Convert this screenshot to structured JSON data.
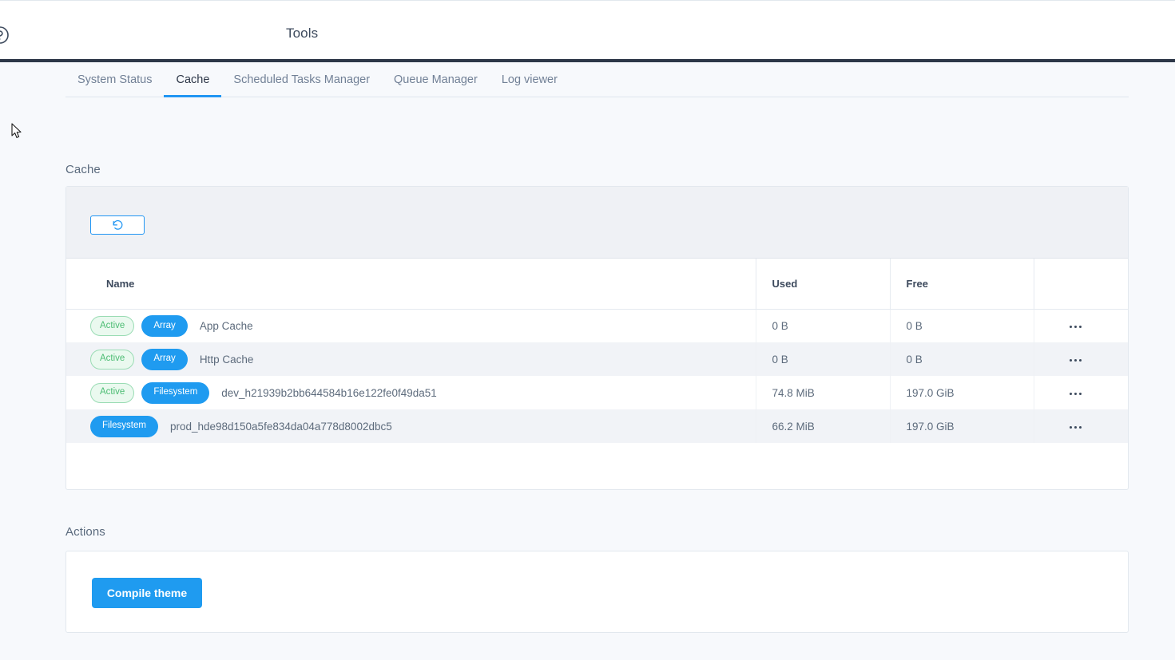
{
  "header": {
    "title": "Tools",
    "help_icon": "help-circle-icon"
  },
  "tabs": [
    {
      "label": "System Status",
      "active": false
    },
    {
      "label": "Cache",
      "active": true
    },
    {
      "label": "Scheduled Tasks Manager",
      "active": false
    },
    {
      "label": "Queue Manager",
      "active": false
    },
    {
      "label": "Log viewer",
      "active": false
    }
  ],
  "cache": {
    "section_label": "Cache",
    "toolbar": {
      "refresh_icon": "refresh-ccw-icon",
      "refresh_title": "Refresh"
    },
    "columns": [
      "Name",
      "Used",
      "Free",
      ""
    ],
    "rows": [
      {
        "status": "Active",
        "type": "Array",
        "name": "App Cache",
        "used": "0 B",
        "free": "0 B",
        "menu_icon": "ellipsis-icon"
      },
      {
        "status": "Active",
        "type": "Array",
        "name": "Http Cache",
        "used": "0 B",
        "free": "0 B",
        "menu_icon": "ellipsis-icon"
      },
      {
        "status": "Active",
        "type": "Filesystem",
        "name": "dev_h21939b2bb644584b16e122fe0f49da51",
        "used": "74.8 MiB",
        "free": "197.0 GiB",
        "menu_icon": "ellipsis-icon"
      },
      {
        "status": "",
        "type": "Filesystem",
        "name": "prod_hde98d150a5fe834da04a778d8002dbc5",
        "used": "66.2 MiB",
        "free": "197.0 GiB",
        "menu_icon": "ellipsis-icon"
      }
    ]
  },
  "actions": {
    "section_label": "Actions",
    "compile_theme_label": "Compile theme"
  },
  "colors": {
    "accent_blue": "#1f9bf0",
    "tab_underline": "#2196f3",
    "header_rule": "#2d3748",
    "status_green_text": "#4dbd74",
    "status_green_bg": "#eaf9ef",
    "status_green_border": "#9adcb4",
    "page_bg": "#f7f9fc",
    "toolbar_bg": "#eff1f5",
    "row_alt_bg": "#f1f3f7"
  }
}
